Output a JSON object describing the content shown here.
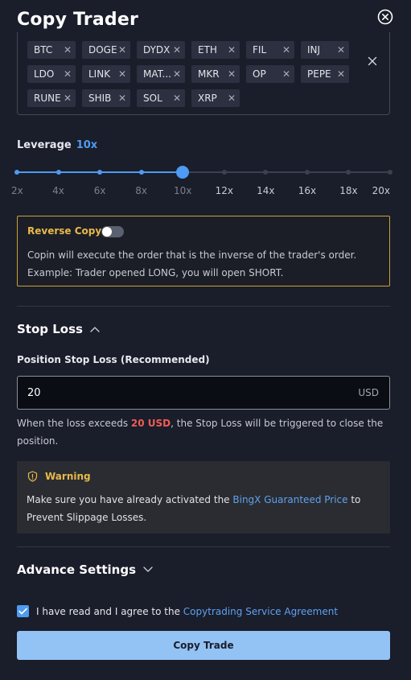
{
  "header": {
    "title": "Copy Trader"
  },
  "tokens": {
    "rows": [
      [
        "BTC",
        "DOGE",
        "DYDX",
        "ETH",
        "FIL",
        "INJ"
      ],
      [
        "LDO",
        "LINK",
        "MAT...",
        "MKR",
        "OP",
        "PEPE"
      ],
      [
        "RUNE",
        "SHIB",
        "SOL",
        "XRP"
      ]
    ]
  },
  "leverage": {
    "label": "Leverage",
    "value_label": "10x",
    "value": 10,
    "ticks": [
      "2x",
      "4x",
      "6x",
      "8x",
      "10x",
      "12x",
      "14x",
      "16x",
      "18x",
      "20x"
    ]
  },
  "reverse_copy": {
    "title": "Reverse Copy",
    "enabled": false,
    "line1": "Copin will execute the order that is the inverse of the trader's order.",
    "line2": "Example: Trader opened LONG, you will open SHORT."
  },
  "stop_loss": {
    "section_title": "Stop Loss",
    "field_label": "Position Stop Loss (Recommended)",
    "value": "20",
    "unit": "USD",
    "note_prefix": "When the loss exceeds ",
    "note_amount": "20 USD",
    "note_suffix": ", the Stop Loss will be triggered to close the position."
  },
  "warning": {
    "title": "Warning",
    "text_prefix": "Make sure you have already activated the ",
    "link": "BingX Guaranteed Price",
    "text_suffix": " to Prevent Slippage Losses."
  },
  "advance": {
    "title": "Advance Settings"
  },
  "agreement": {
    "checked": true,
    "prefix": "I have read and I agree to the ",
    "link": "Copytrading Service Agreement"
  },
  "submit": {
    "label": "Copy Trade"
  },
  "colors": {
    "accent": "#4d9bf2",
    "warning": "#e8b94a",
    "danger": "#ef5c55",
    "background": "#1a1d2a"
  }
}
